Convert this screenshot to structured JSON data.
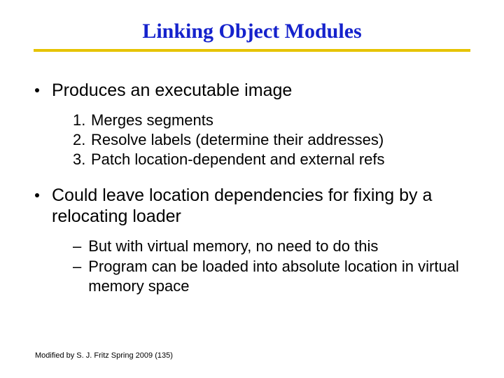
{
  "title": "Linking Object Modules",
  "bullets": [
    {
      "text": "Produces an executable image",
      "sub_type": "numbered",
      "subs": [
        "Merges segments",
        "Resolve labels (determine their addresses)",
        "Patch location-dependent and external refs"
      ]
    },
    {
      "text": "Could leave location dependencies for fixing by a relocating loader",
      "sub_type": "dash",
      "subs": [
        "But with virtual memory, no need to do this",
        "Program can be loaded into absolute location in virtual memory space"
      ]
    }
  ],
  "footer": "Modified by S. J. Fritz  Spring 2009 (135)"
}
